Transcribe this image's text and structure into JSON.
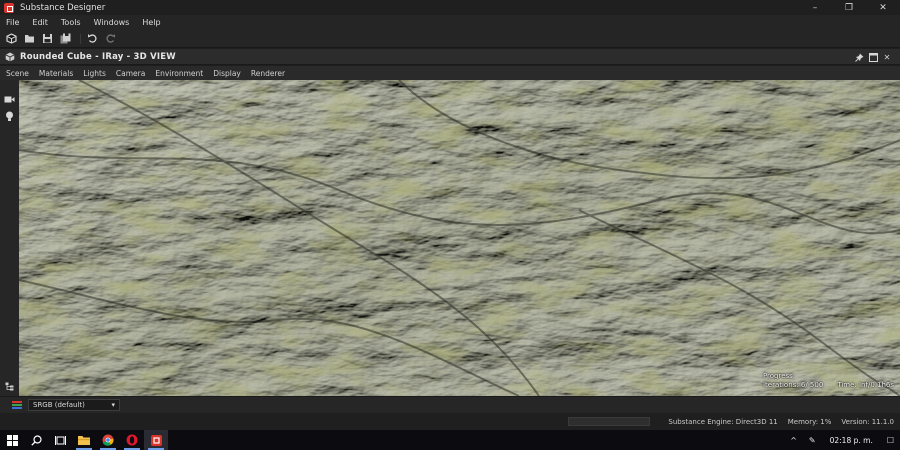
{
  "app": {
    "title": "Substance Designer",
    "icon": "substance-designer-icon"
  },
  "window_controls": {
    "minimize": "–",
    "maximize": "❐",
    "close": "✕"
  },
  "menu": [
    "File",
    "Edit",
    "Tools",
    "Windows",
    "Help"
  ],
  "toolbar": {
    "icons": [
      "new-package-icon",
      "open-icon",
      "save-icon",
      "save-all-icon",
      "undo-icon",
      "redo-icon"
    ]
  },
  "panel": {
    "title": "Rounded Cube - IRay - 3D VIEW",
    "icon": "cube-icon",
    "controls": [
      "pin-icon",
      "float-icon",
      "close-icon"
    ],
    "close_label": "✕"
  },
  "view_menu": [
    "Scene",
    "Materials",
    "Lights",
    "Camera",
    "Environment",
    "Display",
    "Renderer"
  ],
  "viewport": {
    "stats": {
      "line1": "Progress:",
      "iterations": "Iterations: 6/ 500",
      "time": "Time: Inf/0.1h6s"
    }
  },
  "bottom": {
    "colorspace": "SRGB (default)",
    "dropdown_arrow": "▾"
  },
  "status": {
    "engine": "Substance Engine: Direct3D 11",
    "memory": "Memory: 1%",
    "version": "Version: 11.1.0"
  },
  "taskbar": {
    "icons": [
      "windows-start-icon",
      "search-icon",
      "task-view-icon",
      "file-explorer-icon",
      "chrome-icon",
      "opera-icon",
      "substance-designer-icon"
    ],
    "tray": {
      "chevron": "^",
      "pen": "✎",
      "clock": "02:18 p. m.",
      "notification": "☐"
    }
  },
  "colors": {
    "accent": "#d9342b",
    "panel": "#2c2c2c",
    "background": "#1e1e1e"
  }
}
